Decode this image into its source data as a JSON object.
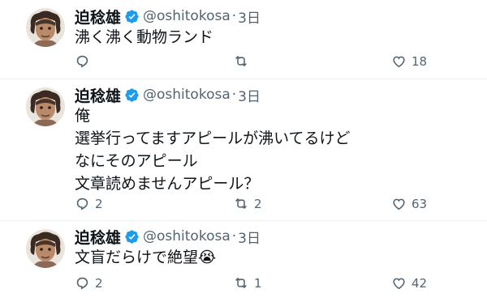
{
  "tweets": [
    {
      "author_name": "迫稔雄",
      "handle": "@oshitokosa",
      "separator": "·",
      "time": "3日",
      "lines": [
        "沸く沸く動物ランド"
      ],
      "reply_count": "",
      "retweet_count": "",
      "like_count": "18"
    },
    {
      "author_name": "迫稔雄",
      "handle": "@oshitokosa",
      "separator": "·",
      "time": "3日",
      "lines": [
        "俺",
        "選挙行ってますアピールが沸いてるけど",
        "なにそのアピール",
        "文章読めませんアピール？"
      ],
      "reply_count": "2",
      "retweet_count": "2",
      "like_count": "63"
    },
    {
      "author_name": "迫稔雄",
      "handle": "@oshitokosa",
      "separator": "·",
      "time": "3日",
      "lines": [
        "文盲だらけで絶望😭"
      ],
      "reply_count": "2",
      "retweet_count": "1",
      "like_count": "42"
    }
  ],
  "icons": {
    "verified": "verified-badge-icon",
    "reply": "reply-icon",
    "retweet": "retweet-icon",
    "like": "like-icon"
  },
  "colors": {
    "verified_blue": "#1d9bf0",
    "secondary_text": "#536471",
    "divider": "#eff3f4"
  }
}
